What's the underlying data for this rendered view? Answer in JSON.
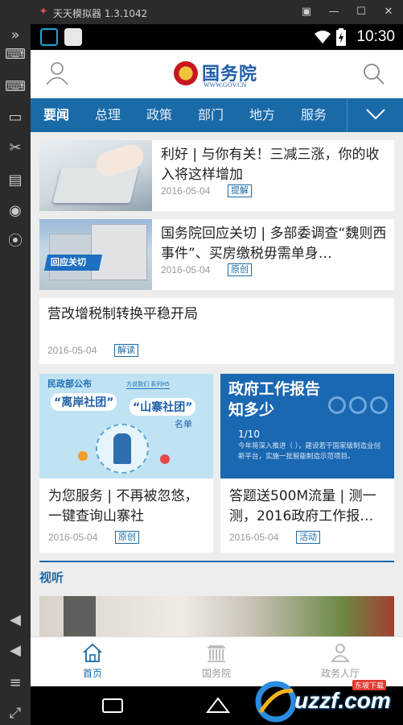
{
  "emulator": {
    "title": "天天模拟器 1.3.1042",
    "window_buttons": [
      "restore-icon",
      "minimize-icon",
      "maximize-icon",
      "close-icon"
    ],
    "side_buttons": [
      "keyboard-icon",
      "keymap-icon",
      "screenshot-icon",
      "scissors-icon",
      "folder-icon",
      "apk-install-icon",
      "location-icon",
      "volume-up-icon",
      "volume-down-icon",
      "menu-icon",
      "fullscreen-icon"
    ]
  },
  "status": {
    "time": "10:30"
  },
  "header": {
    "brand_cn": "国务院",
    "brand_url": "WWW.GOV.CN"
  },
  "tabs": [
    "要闻",
    "总理",
    "政策",
    "部门",
    "地方",
    "服务"
  ],
  "feed": {
    "items": [
      {
        "title": "利好 | 与你有关！三减三涨，你的收入将这样增加",
        "date": "2016-05-04",
        "tag": "提解"
      },
      {
        "title": "国务院回应关切 | 多部委调查“魏则西事件”、买房缴税毋需单身…",
        "date": "2016-05-04",
        "tag": "原创",
        "thumb_caption": "回应关切"
      },
      {
        "title": "营改增税制转换平稳开局",
        "date": "2016-05-04",
        "tag": "解读"
      }
    ],
    "grid": [
      {
        "title": "为您服务 | 不再被忽悠，一键查询山寨社",
        "date": "2016-05-04",
        "tag": "原创",
        "thumb_texts": [
          "民政部公布",
          "“离岸社团”",
          "“山寨社团”",
          "名单",
          "方说我们 系列H5"
        ]
      },
      {
        "title": "答题送500M流量 | 测一测，2016政府工作报…",
        "date": "2016-05-04",
        "tag": "活动",
        "thumb_texts": [
          "政府工作报告",
          "知多少",
          "1/10",
          "今年将深入推进（ ），建设若干国家级制造业创新平台，实施一批智能制造示范项目。"
        ]
      }
    ],
    "section": "视听"
  },
  "bottom_nav": [
    {
      "label": "首页",
      "icon": "home-icon",
      "active": true
    },
    {
      "label": "国务院",
      "icon": "building-icon",
      "active": false
    },
    {
      "label": "政务人厅",
      "icon": "person-hall-icon",
      "active": false
    }
  ],
  "watermark": {
    "text": "uzzf.com",
    "badge": "东坡下载"
  },
  "colors": {
    "brand_blue": "#1a6aa8",
    "nav_bar": "#1a6aa8",
    "emulator_frame": "#2b2b2b"
  }
}
